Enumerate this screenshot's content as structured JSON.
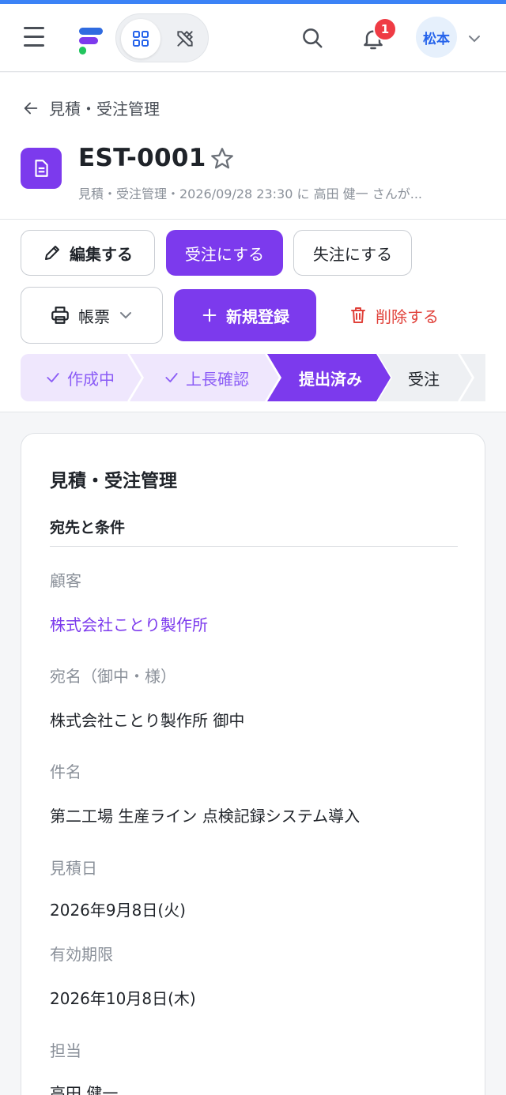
{
  "header": {
    "notification_count": "1",
    "user_name": "松本"
  },
  "page": {
    "back_label": "見積・受注管理",
    "title": "EST-0001",
    "subtitle": "見積・受注管理・2026/09/28 23:30 に 高田 健一 さんが..."
  },
  "actions": {
    "edit": "編集する",
    "order": "受注にする",
    "lost": "失注にする",
    "print": "帳票",
    "new": "新規登録",
    "delete": "削除する"
  },
  "stepper": {
    "steps": [
      {
        "label": "作成中",
        "state": "done"
      },
      {
        "label": "上長確認",
        "state": "done"
      },
      {
        "label": "提出済み",
        "state": "current"
      },
      {
        "label": "受注",
        "state": "todo"
      }
    ]
  },
  "card": {
    "title": "見積・受注管理",
    "section": "宛先と条件",
    "fields": [
      {
        "label": "顧客",
        "value": "株式会社ことり製作所"
      },
      {
        "label": "宛名（御中・様）",
        "value": "株式会社ことり製作所 御中"
      },
      {
        "label": "件名",
        "value": "第二工場 生産ライン 点検記録システム導入"
      },
      {
        "label": "見積日",
        "value": "2026年9月8日(火)"
      },
      {
        "label": "有効期限",
        "value": "2026年10月8日(木)"
      },
      {
        "label": "担当",
        "value": "高田 健一"
      }
    ]
  },
  "colors": {
    "accent": "#7c3aed",
    "danger": "#e0413a",
    "badge": "#ef3b44",
    "link": "#7c3aed"
  }
}
